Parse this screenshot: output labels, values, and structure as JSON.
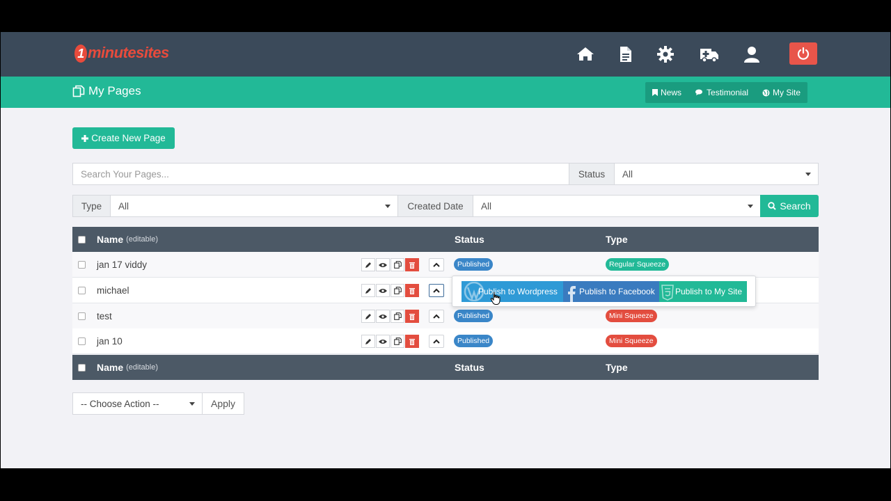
{
  "brand": {
    "logo_mark": "1",
    "logo_text": "minutesites"
  },
  "topnav": {
    "icons": [
      "home-icon",
      "document-icon",
      "gear-icon",
      "ambulance-icon",
      "user-icon",
      "power-icon"
    ],
    "power_color": "#e8554a"
  },
  "subheader": {
    "title": "My Pages",
    "links": [
      {
        "label": "News",
        "icon": "bookmark-icon"
      },
      {
        "label": "Testimonial",
        "icon": "comments-icon"
      },
      {
        "label": "My Site",
        "icon": "globe-icon"
      }
    ]
  },
  "toolbar": {
    "create_label": "Create New Page"
  },
  "filters": {
    "search_placeholder": "Search Your Pages...",
    "status_label": "Status",
    "status_value": "All",
    "type_label": "Type",
    "type_value": "All",
    "date_label": "Created Date",
    "date_value": "All",
    "search_button": "Search"
  },
  "table": {
    "columns": {
      "name": "Name",
      "name_note": "(editable)",
      "status": "Status",
      "type": "Type"
    },
    "rows": [
      {
        "name": "jan 17 viddy",
        "status": "Published",
        "type": "Regular Squeeze",
        "type_color": "#22b997"
      },
      {
        "name": "michael",
        "status": "",
        "type": "",
        "type_color": ""
      },
      {
        "name": "test",
        "status": "Published",
        "type": "Mini Squeeze",
        "type_color": "#e34d3f"
      },
      {
        "name": "jan 10",
        "status": "Published",
        "type": "Mini Squeeze",
        "type_color": "#e34d3f"
      }
    ]
  },
  "publish_popover": {
    "wordpress": "Publish to Wordpress",
    "facebook": "Publish to Facebook",
    "mysite": "Publish to My Site"
  },
  "bulk": {
    "choose_action": "-- Choose Action --",
    "apply": "Apply"
  },
  "colors": {
    "accent": "#22b997",
    "header": "#3b4a5a",
    "status_badge": "#3a86c8",
    "danger": "#e34d3f"
  }
}
